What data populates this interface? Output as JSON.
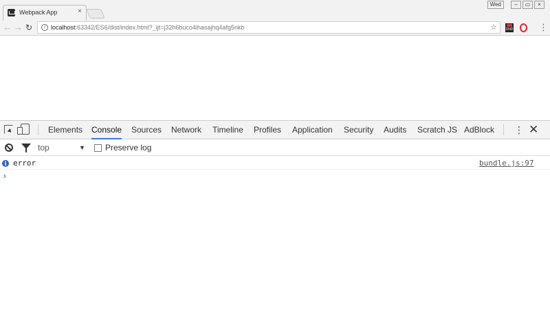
{
  "browser": {
    "tab_title": "Webpack App",
    "tab_close": "×",
    "user_badge": "Wed",
    "window_buttons": [
      "–",
      "▭",
      "×"
    ],
    "url_host": "localhost",
    "url_rest": ":63342/ES6/dist/index.html?_ijt=j32h6buco4ihasajhq4afg5nkb",
    "ext_label": "DND"
  },
  "devtools": {
    "tabs": [
      "Elements",
      "Console",
      "Sources",
      "Network",
      "Timeline",
      "Profiles",
      "Application",
      "Security",
      "Audits",
      "Scratch JS",
      "AdBlock"
    ],
    "active_tab": "Console",
    "more": "⋮",
    "close": "✕"
  },
  "console": {
    "context": "top",
    "context_arrow": "▼",
    "preserve_log_label": "Preserve log",
    "preserve_log_checked": false,
    "messages": [
      {
        "level": "info",
        "icon": "info-icon",
        "text": "error",
        "source": "bundle.js:97"
      }
    ],
    "prompt_glyph": "›"
  }
}
